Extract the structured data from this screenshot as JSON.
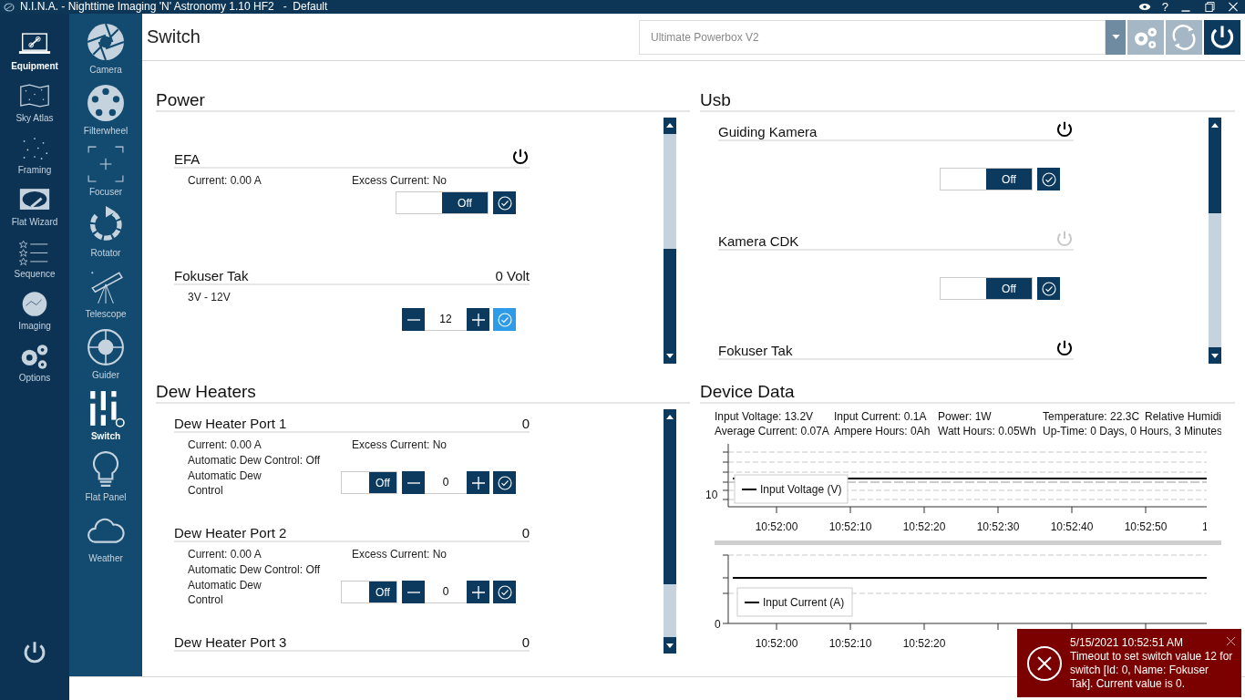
{
  "window": {
    "title": "N.I.N.A. - Nighttime Imaging 'N' Astronomy 1.10 HF2   -  Default",
    "help": "?"
  },
  "nav": [
    {
      "label": "Equipment",
      "selected": true
    },
    {
      "label": "Sky Atlas",
      "selected": false
    },
    {
      "label": "Framing",
      "selected": false
    },
    {
      "label": "Flat Wizard",
      "selected": false
    },
    {
      "label": "Sequence",
      "selected": false
    },
    {
      "label": "Imaging",
      "selected": false
    },
    {
      "label": "Options",
      "selected": false
    }
  ],
  "equipment_nav": [
    {
      "label": "Camera",
      "selected": false
    },
    {
      "label": "Filterwheel",
      "selected": false
    },
    {
      "label": "Focuser",
      "selected": false
    },
    {
      "label": "Rotator",
      "selected": false
    },
    {
      "label": "Telescope",
      "selected": false
    },
    {
      "label": "Guider",
      "selected": false
    },
    {
      "label": "Switch",
      "selected": true
    },
    {
      "label": "Flat Panel",
      "selected": false
    },
    {
      "label": "Weather",
      "selected": false
    }
  ],
  "page": {
    "title": "Switch",
    "device": "Ultimate Powerbox V2"
  },
  "power": {
    "title": "Power",
    "items": [
      {
        "kind": "toggle",
        "name": "EFA",
        "on": true,
        "current": "Current: 0.00 A",
        "excess": "Excess Current: No",
        "switch": {
          "label": "Off",
          "on": false
        }
      },
      {
        "kind": "number",
        "name": "Fokuser Tak",
        "value": "0 Volt",
        "range": "3V - 12V",
        "input": "12",
        "confirm_active": true
      }
    ]
  },
  "usb": {
    "title": "Usb",
    "items": [
      {
        "kind": "toggle",
        "name": "Guiding Kamera",
        "on": true,
        "switch": {
          "label": "Off",
          "on": false
        }
      },
      {
        "kind": "toggle",
        "name": "Kamera CDK",
        "on": false,
        "switch": {
          "label": "Off",
          "on": false
        }
      },
      {
        "kind": "toggle",
        "name": "Fokuser Tak",
        "on": true
      }
    ]
  },
  "dew_heaters": {
    "title": "Dew Heaters",
    "items": [
      {
        "kind": "dew",
        "name": "Dew Heater Port 1",
        "value": "0",
        "current": "Current: 0.00 A",
        "excess": "Excess Current: No",
        "auto_status": "Automatic Dew Control: Off",
        "auto_label": "Automatic Dew Control",
        "switch": {
          "label": "Off",
          "on": false
        },
        "input": "0",
        "confirm_active": false
      },
      {
        "kind": "dew",
        "name": "Dew Heater Port 2",
        "value": "0",
        "current": "Current: 0.00 A",
        "excess": "Excess Current: No",
        "auto_status": "Automatic Dew Control: Off",
        "auto_label": "Automatic Dew Control",
        "switch": {
          "label": "Off",
          "on": false
        },
        "input": "0",
        "confirm_active": false
      },
      {
        "kind": "dew",
        "name": "Dew Heater Port 3",
        "value": "0"
      }
    ]
  },
  "device_data": {
    "title": "Device Data",
    "stats": [
      [
        "Input Voltage: 13.2V",
        "Input Current: 0.1A",
        "Power: 1W",
        "Temperature: 22.3C",
        "Relative Humidi"
      ],
      [
        "Average Current: 0.07A",
        "Ampere Hours: 0Ah",
        "Watt Hours: 0.05Wh",
        "Up-Time: 0 Days, 0 Hours, 3 Minutes"
      ]
    ],
    "charts": [
      {
        "legend": "Input Voltage (V)",
        "y_label": "10",
        "x_labels": [
          "10:52:00",
          "10:52:10",
          "10:52:20",
          "10:52:30",
          "10:52:40",
          "10:52:50",
          "1"
        ]
      },
      {
        "legend": "Input Current (A)",
        "y_label": "0",
        "x_labels": [
          "10:52:00",
          "10:52:10",
          "10:52:20"
        ]
      }
    ]
  },
  "notification": {
    "time": "5/15/2021 10:52:51 AM",
    "message": "Timeout to set switch value 12 for switch [Id: 0, Name: Fokuser Tak]. Current value is 0."
  }
}
